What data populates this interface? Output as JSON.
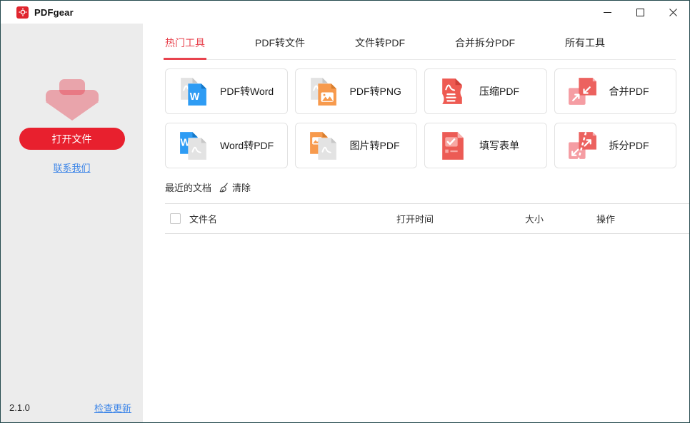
{
  "window": {
    "title": "PDFgear",
    "controls": {
      "minimize": "minimize",
      "maximize": "maximize",
      "close": "close"
    }
  },
  "sidebar": {
    "open_button_label": "打开文件",
    "contact_link_label": "联系我们",
    "version": "2.1.0",
    "update_link_label": "检查更新"
  },
  "tabs": [
    {
      "label": "热门工具",
      "active": true
    },
    {
      "label": "PDF转文件",
      "active": false
    },
    {
      "label": "文件转PDF",
      "active": false
    },
    {
      "label": "合并拆分PDF",
      "active": false
    },
    {
      "label": "所有工具",
      "active": false
    }
  ],
  "tools": [
    {
      "label": "PDF转Word",
      "icon": "pdf-to-word-icon"
    },
    {
      "label": "PDF转PNG",
      "icon": "pdf-to-png-icon"
    },
    {
      "label": "压缩PDF",
      "icon": "compress-pdf-icon"
    },
    {
      "label": "合并PDF",
      "icon": "merge-pdf-icon"
    },
    {
      "label": "Word转PDF",
      "icon": "word-to-pdf-icon"
    },
    {
      "label": "图片转PDF",
      "icon": "image-to-pdf-icon"
    },
    {
      "label": "填写表单",
      "icon": "fill-forms-icon"
    },
    {
      "label": "拆分PDF",
      "icon": "split-pdf-icon"
    }
  ],
  "recent": {
    "title": "最近的文档",
    "clear_label": "清除"
  },
  "table": {
    "headers": [
      "文件名",
      "打开时间",
      "大小",
      "操作"
    ],
    "rows": []
  },
  "icons": {
    "app-logo": "red square with white gear",
    "download-arrow": "translucent red down arrow",
    "clear-broom": "broom sweep glyph",
    "minimize": "—",
    "maximize": "□",
    "close": "✕"
  },
  "colors": {
    "accent_red": "#e8202e",
    "tab_active_red": "#e8434e",
    "brand_icon_red": "#ee5a52",
    "brand_icon_pink": "#f59da3",
    "link_blue": "#3e86e8",
    "word_blue": "#2e9cf4",
    "image_orange": "#f79a4d",
    "sidebar_gray": "#ececec",
    "window_border": "#24494d"
  }
}
